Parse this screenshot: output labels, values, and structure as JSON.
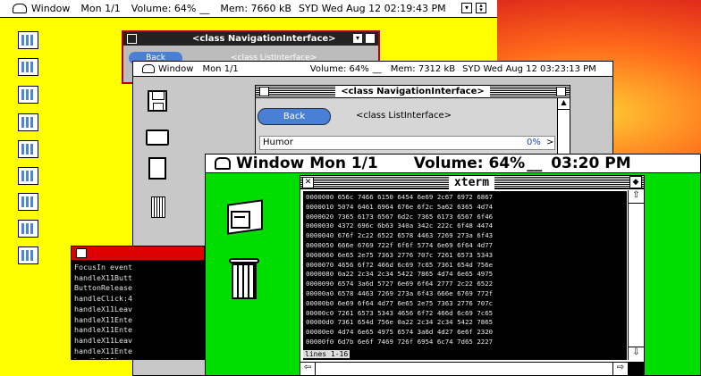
{
  "menubar": {
    "apple_menu": "Window",
    "monitor": "Mon 1/1",
    "volume": "Volume: 64%",
    "volume_bar": "__",
    "mem": "Mem: 7660 kB",
    "clock": "SYD Wed Aug 12 02:19:43 PM"
  },
  "nav_back_window": {
    "title": "<class NavigationInterface>",
    "back_label": "Back",
    "list_title": "<class ListInterface>"
  },
  "mid_window": {
    "menubar": {
      "apple_menu": "Window",
      "monitor": "Mon 1/1",
      "volume": "Volume: 64%",
      "volume_bar": "__",
      "mem": "Mem: 7312 kB",
      "clock": "SYD Wed Aug 12 03:23:13 PM"
    }
  },
  "nav_window": {
    "title": "<class NavigationInterface>",
    "back_label": "Back",
    "list_title": "<class ListInterface>",
    "list_item": "Humor",
    "list_item_percent": "0%",
    "list_item_arrow": ">"
  },
  "green_window": {
    "apple_menu": "Window",
    "monitor": "Mon 1/1",
    "volume": "Volume: 64%",
    "volume_bar": "__",
    "clock": "03:20 PM"
  },
  "xterm": {
    "title": "xterm",
    "lines": [
      "0000000 656c 7466 6150 6454 6e69 2c67 6972 6867",
      "0000010 5074 6461 6964 676e 6f2c 5a62 6365 4d74",
      "0000020 7365 6173 6567 6d2c 7365 6173 6567 6f46",
      "0000030 4372 696c 6b63 340a 342c 222c 6f48 4474",
      "0000040 676f 2c22 6522 6578 4463 7269 273a 6f43",
      "0000050 666e 6769 722f 6f6f 5774 6e69 6f64 4d77",
      "0000060 6e65 2e75 7363 2776 707c 7261 6573 5343",
      "0000070 4656 6f72 466d 6c69 7c65 7361 654d 756e",
      "0000080 0a22 2c34 2c34 5422 7865 4d74 6e65 4975",
      "0000090 6574 3a6d 5727 6e69 6f64 2777 2c22 6522",
      "00000a0 6578 4463 7269 273a 6f43 666e 6769 772f",
      "00000b0 6e69 6f64 4d77 6e65 2e75 7363 2776 707c",
      "00000c0 7261 6573 5343 4656 6f72 466d 6c69 7c65",
      "00000d0 7361 654d 756e 0a22 2c34 2c34 5422 7865",
      "00000e0 4d74 6e65 4975 6574 3a6d 4d27 6e6f 2320",
      "00000f0 6d7b 6e6f 7469 726f 6954 6c74 7d65 2227"
    ],
    "status": "lines 1-16"
  },
  "terminal": {
    "lines": [
      "FocusIn event",
      "handleX11Butt",
      "ButtonRelease",
      "handleClick:4",
      "handleX11Leav",
      "handleX11Ente",
      "handleX11Ente",
      "handleX11Leav",
      "handleX11Ente",
      "handleX11Leav"
    ]
  },
  "icons": {
    "disk": "floppy-disk-icon",
    "folder": "folder-icon",
    "document": "document-icon",
    "trash": "trash-icon",
    "cabinet": "file-cabinet-icon",
    "bigtrash": "trash-can-icon"
  },
  "colors": {
    "yellow_desktop": "#ffff00",
    "green_desktop": "#00dd00",
    "terminal_title": "#dd0000",
    "back_button": "#4a7fd6"
  }
}
